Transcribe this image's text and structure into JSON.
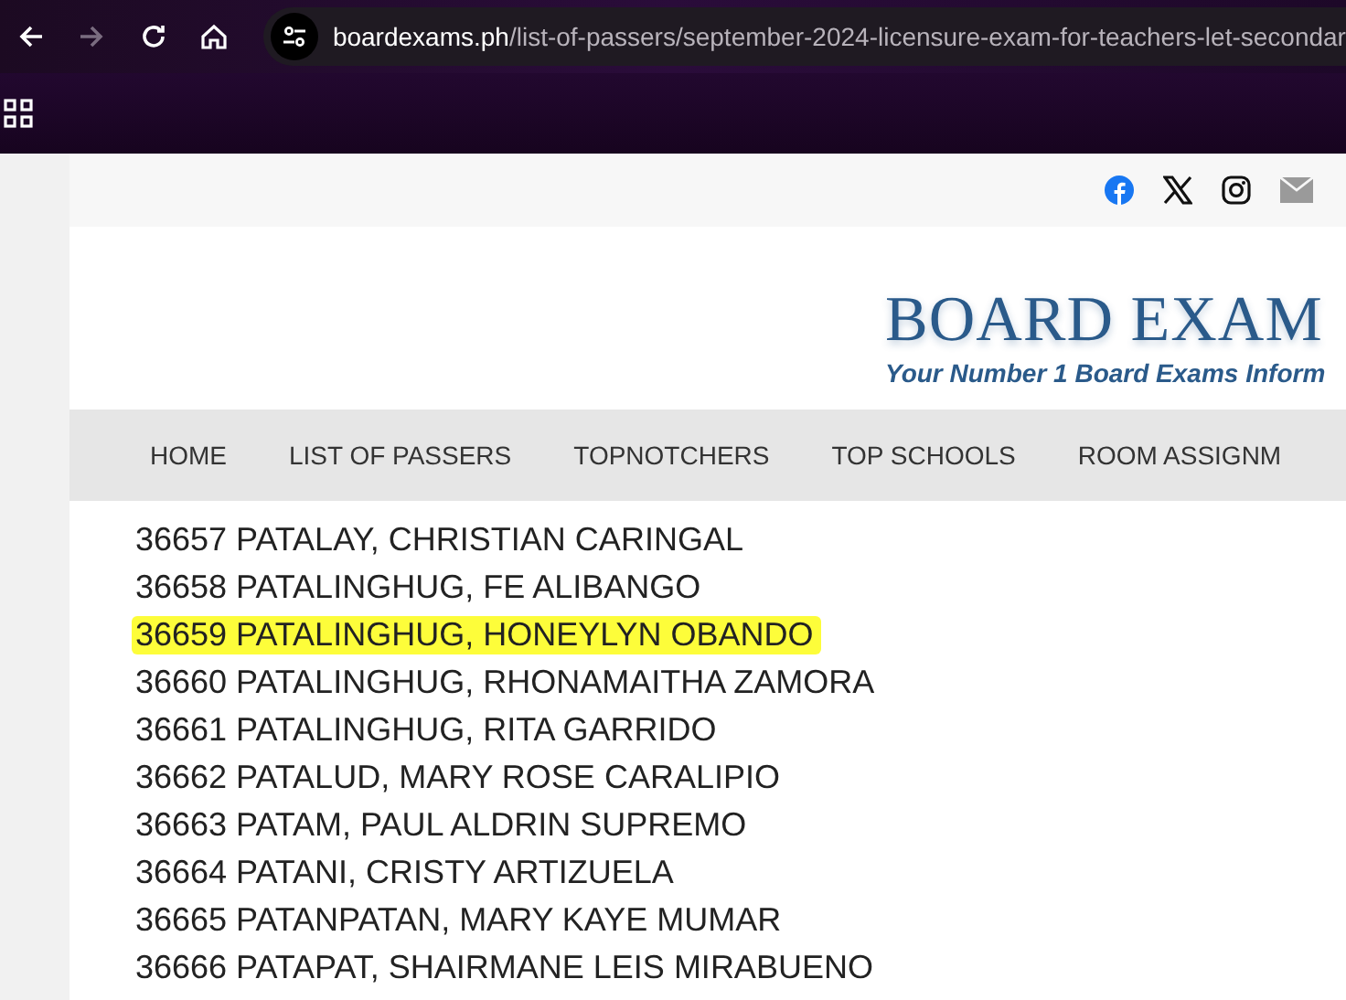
{
  "browser": {
    "url_host": "boardexams.ph",
    "url_path": "/list-of-passers/september-2024-licensure-exam-for-teachers-let-secondar"
  },
  "site": {
    "logo_title": "BOARD EXAM",
    "logo_tagline": "Your Number 1 Board Exams Inform"
  },
  "nav": [
    "HOME",
    "LIST OF PASSERS",
    "TOPNOTCHERS",
    "TOP SCHOOLS",
    "ROOM ASSIGNM"
  ],
  "passers": [
    {
      "text": "36657 PATALAY, CHRISTIAN CARINGAL",
      "highlighted": false
    },
    {
      "text": "36658 PATALINGHUG, FE ALIBANGO",
      "highlighted": false
    },
    {
      "text": "36659 PATALINGHUG, HONEYLYN OBANDO",
      "highlighted": true
    },
    {
      "text": "36660 PATALINGHUG, RHONAMAITHA ZAMORA",
      "highlighted": false
    },
    {
      "text": "36661 PATALINGHUG, RITA GARRIDO",
      "highlighted": false
    },
    {
      "text": "36662 PATALUD, MARY ROSE CARALIPIO",
      "highlighted": false
    },
    {
      "text": "36663 PATAM, PAUL ALDRIN SUPREMO",
      "highlighted": false
    },
    {
      "text": "36664 PATANI, CRISTY ARTIZUELA",
      "highlighted": false
    },
    {
      "text": "36665 PATANPATAN, MARY KAYE MUMAR",
      "highlighted": false
    },
    {
      "text": "36666 PATAPAT, SHAIRMANE LEIS MIRABUENO",
      "highlighted": false
    }
  ]
}
